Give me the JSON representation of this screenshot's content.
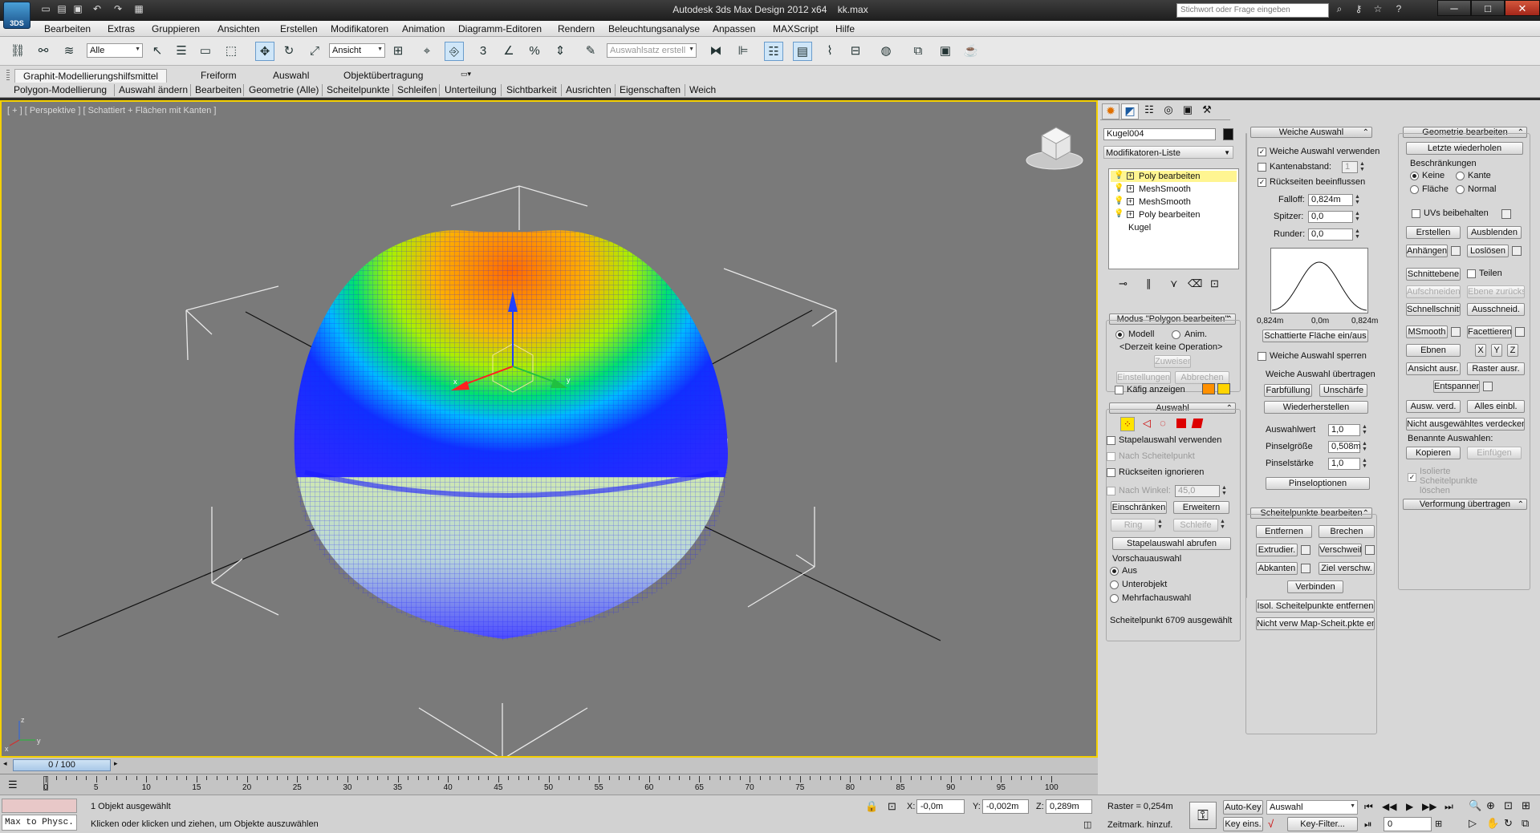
{
  "app": {
    "logo_text": "3DS",
    "title": "Autodesk 3ds Max Design 2012 x64",
    "file": "kk.max"
  },
  "titlebar": {
    "search_placeholder": "Stichwort oder Frage eingeben",
    "win_min": "─",
    "win_max": "□",
    "win_close": "✕"
  },
  "menu": [
    "Bearbeiten",
    "Extras",
    "Gruppieren",
    "Ansichten",
    "Erstellen",
    "Modifikatoren",
    "Animation",
    "Diagramm-Editoren",
    "Rendern",
    "Beleuchtungsanalyse",
    "Anpassen",
    "MAXScript",
    "Hilfe"
  ],
  "toolbar": {
    "selection_filter": "Alle",
    "refcoord": "Ansicht",
    "named_selection_placeholder": "Auswahlsatz erstell"
  },
  "ribbon": {
    "tabs": [
      "Graphit-Modellierungshilfsmittel",
      "Freiform",
      "Auswahl",
      "Objektübertragung"
    ],
    "panels": [
      "Polygon-Modellierung",
      "Auswahl ändern",
      "Bearbeiten",
      "Geometrie (Alle)",
      "Scheitelpunkte",
      "Schleifen",
      "Unterteilung",
      "Sichtbarkeit",
      "Ausrichten",
      "Eigenschaften",
      "Weich"
    ]
  },
  "viewport": {
    "label": "[ + ] [ Perspektive ] [ Schattiert + Flächen mit Kanten ]"
  },
  "modify": {
    "object_name": "Kugel004",
    "modifier_list_label": "Modifikatoren-Liste",
    "stack": [
      "Poly bearbeiten",
      "MeshSmooth",
      "MeshSmooth",
      "Poly bearbeiten"
    ],
    "base": "Kugel",
    "stack_selected_index": 0,
    "mode": {
      "title": "Modus \"Polygon bearbeiten\"",
      "model": "Modell",
      "anim": "Anim.",
      "status": "<Derzeit keine Operation>",
      "assign": "Zuweisen",
      "settings": "Einstellungen",
      "cancel": "Abbrechen",
      "cage": "Käfig anzeigen",
      "cage_color1": "#ff9000",
      "cage_color2": "#ffd400"
    },
    "selection": {
      "title": "Auswahl",
      "stack_sel": "Stapelauswahl verwenden",
      "by_vertex": "Nach Scheitelpunkt",
      "ignore_back": "Rückseiten ignorieren",
      "by_angle": "Nach Winkel:",
      "angle_val": "45,0",
      "shrink": "Einschränken",
      "grow": "Erweitern",
      "ring": "Ring",
      "loop": "Schleife",
      "get_stack": "Stapelauswahl abrufen",
      "preview": "Vorschauauswahl",
      "off": "Aus",
      "subobj": "Unterobjekt",
      "multi": "Mehrfachauswahl",
      "info": "Scheitelpunkt 6709 ausgewählt"
    }
  },
  "soft": {
    "title": "Weiche Auswahl",
    "use": "Weiche Auswahl verwenden",
    "edge_dist": "Kantenabstand:",
    "edge_val": "1",
    "affect_back": "Rückseiten beeinflussen",
    "falloff_label": "Falloff:",
    "falloff": "0,824m",
    "pinch_label": "Spitzer:",
    "pinch": "0,0",
    "bubble_label": "Runder:",
    "bubble": "0,0",
    "curve_left": "0,824m",
    "curve_mid": "0,0m",
    "curve_right": "0,824m",
    "shaded": "Schattierte Fläche ein/aus",
    "lock": "Weiche Auswahl sperren",
    "paint_title": "Weiche Auswahl übertragen",
    "paint": "Farbfüllung",
    "blur": "Unschärfe",
    "revert": "Wiederherstellen",
    "sel_value_label": "Auswahlwert",
    "sel_value": "1,0",
    "brush_size_label": "Pinselgröße",
    "brush_size": "0,508m",
    "brush_strength_label": "Pinselstärke",
    "brush_strength": "1,0",
    "brush_opts": "Pinseloptionen"
  },
  "edit_vertices": {
    "title": "Scheitelpunkte bearbeiten",
    "remove": "Entfernen",
    "break": "Brechen",
    "extrude": "Extrudier.",
    "weld": "Verschweiß.",
    "chamfer": "Abkanten",
    "target_weld": "Ziel verschw.",
    "connect": "Verbinden",
    "remove_iso": "Isol. Scheitelpunkte entfernen",
    "remove_unused": "Nicht verw Map-Scheit.pkte entf"
  },
  "geometry": {
    "title": "Geometrie bearbeiten",
    "repeat": "Letzte wiederholen",
    "constraints": "Beschränkungen",
    "none": "Keine",
    "edge": "Kante",
    "face": "Fläche",
    "normal": "Normal",
    "preserve_uvs": "UVs beibehalten",
    "create": "Erstellen",
    "collapse": "Ausblenden",
    "attach": "Anhängen",
    "detach": "Loslösen",
    "slice_plane": "Schnittebene",
    "split": "Teilen",
    "slice": "Aufschneiden",
    "reset_plane": "Ebene zurücks.",
    "quickslice": "Schnellschnitt",
    "cut": "Ausschneid.",
    "msmooth": "MSmooth",
    "tessellate": "Facettieren",
    "make_planar": "Ebnen",
    "x": "X",
    "y": "Y",
    "z": "Z",
    "view_align": "Ansicht ausr.",
    "grid_align": "Raster ausr.",
    "relax": "Entspannen",
    "hide_sel": "Ausw. verd.",
    "unhide_all": "Alles einbl.",
    "hide_unsel": "Nicht ausgewähltes verdecken",
    "named_sel": "Benannte Auswahlen:",
    "copy": "Kopieren",
    "paste": "Einfügen",
    "delete_iso": "Isolierte Scheitelpunkte löschen",
    "deform_title": "Verformung übertragen"
  },
  "timeline": {
    "frame": "0 / 100",
    "ticks": [
      "0",
      "5",
      "10",
      "15",
      "20",
      "25",
      "30",
      "35",
      "40",
      "45",
      "50",
      "55",
      "60",
      "65",
      "70",
      "75",
      "80",
      "85",
      "90",
      "95",
      "100"
    ]
  },
  "status": {
    "script_box": "Max to Physc.",
    "selected": "1 Objekt ausgewählt",
    "prompt": "Klicken oder klicken und ziehen, um Objekte auszuwählen",
    "x_label": "X:",
    "x": "-0,0m",
    "y_label": "Y:",
    "y": "-0,002m",
    "z_label": "Z:",
    "z": "0,289m",
    "grid": "Raster = 0,254m",
    "timetag": "Zeitmark. hinzuf.",
    "autokey": "Auto-Key",
    "setkey": "Key eins.",
    "key_mode": "Auswahl",
    "key_filters": "Key-Filter...",
    "frame_field": "0"
  }
}
